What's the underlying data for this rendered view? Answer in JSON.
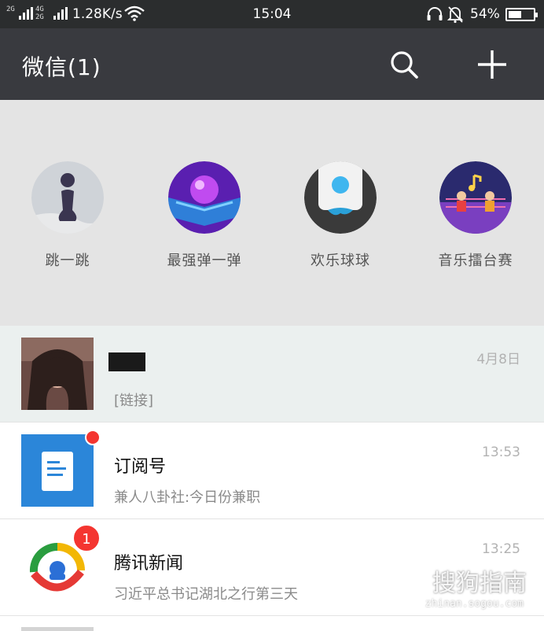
{
  "status_bar": {
    "sim1": "2G",
    "sim2_top": "4G",
    "sim2_bottom": "2G",
    "net_speed": "1.28K/s",
    "time": "15:04",
    "battery_percent": "54%",
    "battery_level": 0.54
  },
  "header": {
    "title": "微信(1)",
    "search_icon": "search-icon",
    "add_icon": "plus-icon"
  },
  "mini_programs": [
    {
      "label": "跳一跳",
      "icon": "jump-game-icon"
    },
    {
      "label": "最强弹一弹",
      "icon": "bounce-ball-icon"
    },
    {
      "label": "欢乐球球",
      "icon": "happy-ball-icon"
    },
    {
      "label": "音乐擂台赛",
      "icon": "music-arena-icon"
    }
  ],
  "chats": [
    {
      "time": "4月8日",
      "preview": "[链接]",
      "pinned": true
    },
    {
      "name": "订阅号",
      "time": "13:53",
      "preview": "兼人八卦社:今日份兼职",
      "unread_dot": true
    },
    {
      "name": "腾讯新闻",
      "time": "13:25",
      "preview": "习近平总书记湖北之行第三天",
      "badge": "1"
    }
  ],
  "watermark": {
    "text": "搜狗指南",
    "url": "zhinan.sogou.com"
  },
  "colors": {
    "status_bg": "#2b2d2e",
    "header_bg": "#393a3f",
    "mini_bg": "#e4e4e4",
    "pinned_bg": "#ebf0ef",
    "badge_red": "#f43530",
    "subscription_blue": "#2b86d9"
  }
}
